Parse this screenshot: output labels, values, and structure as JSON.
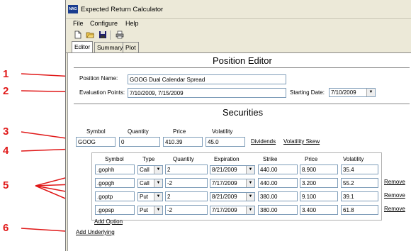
{
  "window": {
    "app_icon": "NAG",
    "title": "Expected Return Calculator"
  },
  "menu": [
    "File",
    "Configure",
    "Help"
  ],
  "toolbar": [
    "new-file-icon",
    "open-folder-icon",
    "save-disk-icon",
    "print-icon"
  ],
  "tabs": [
    "Editor",
    "Summary",
    "Plot"
  ],
  "markers": [
    "1",
    "2",
    "3",
    "4",
    "5",
    "6"
  ],
  "position_editor": {
    "heading": "Position Editor",
    "position_name_label": "Position Name:",
    "position_name_value": "GOOG Dual Calendar Spread",
    "eval_points_label": "Evaluation Points:",
    "eval_points_value": "7/10/2009, 7/15/2009",
    "starting_date_label": "Starting Date:",
    "starting_date_value": "7/10/2009"
  },
  "securities": {
    "heading": "Securities",
    "underlying": {
      "headers": [
        "Symbol",
        "Quantity",
        "Price",
        "Volatility"
      ],
      "symbol": "GOOG",
      "quantity": "0",
      "price": "410.39",
      "volatility": "45.0"
    },
    "dividends_link": "Dividends",
    "volatility_skew_link": "Volatility Skew",
    "option_headers": [
      "Symbol",
      "Type",
      "Quantity",
      "Expiration",
      "Strike",
      "Price",
      "Volatility"
    ],
    "options": [
      {
        "symbol": ".gophh",
        "type": "Call",
        "quantity": "2",
        "expiration": "8/21/2009",
        "strike": "440.00",
        "price": "8.900",
        "volatility": "35.4",
        "remove": ""
      },
      {
        "symbol": ".gopgh",
        "type": "Call",
        "quantity": "-2",
        "expiration": "7/17/2009",
        "strike": "440.00",
        "price": "3.200",
        "volatility": "55.2",
        "remove": "Remove"
      },
      {
        "symbol": ".goptp",
        "type": "Put",
        "quantity": "2",
        "expiration": "8/21/2009",
        "strike": "380.00",
        "price": "9.100",
        "volatility": "39.1",
        "remove": "Remove"
      },
      {
        "symbol": ".gopsp",
        "type": "Put",
        "quantity": "-2",
        "expiration": "7/17/2009",
        "strike": "380.00",
        "price": "3.400",
        "volatility": "61.8",
        "remove": "Remove"
      }
    ],
    "add_option_link": "Add Option",
    "add_underlying_link": "Add Underlying"
  },
  "colors": {
    "annotation": "#e01818",
    "window_bg": "#ece9d8",
    "input_border": "#7f9db9"
  }
}
